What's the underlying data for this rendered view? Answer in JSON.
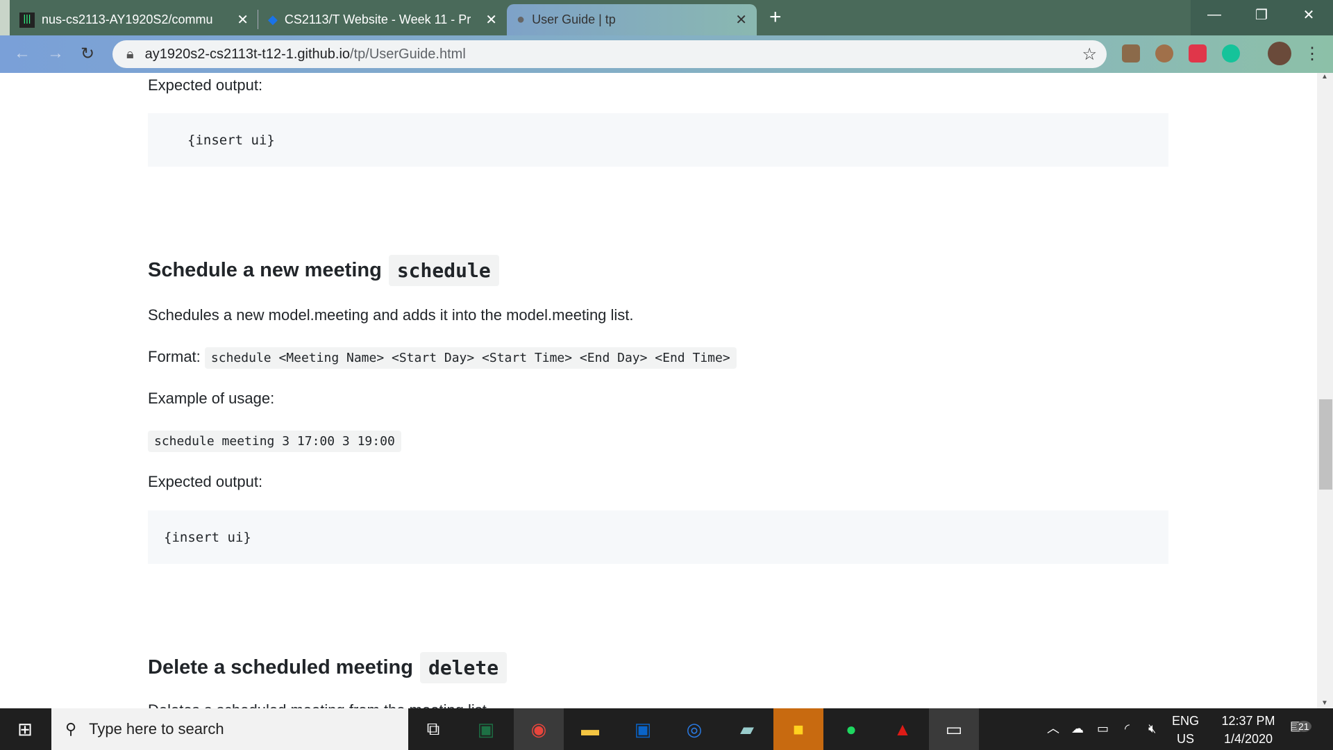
{
  "browser": {
    "tabs": [
      {
        "title": "nus-cs2113-AY1920S2/commu",
        "icon": "gitter-icon"
      },
      {
        "title": "CS2113/T Website - Week 11 - Pr",
        "icon": "graduation-cap-icon"
      },
      {
        "title": "User Guide | tp",
        "icon": "globe-icon",
        "active": true
      }
    ],
    "url_host": "ay1920s2-cs2113t-t12-1.github.io",
    "url_path": "/tp/UserGuide.html"
  },
  "content": {
    "expected_output_1": "Expected output:",
    "code_1": "{insert ui}",
    "schedule_heading": "Schedule a new meeting",
    "schedule_cmd": "schedule",
    "schedule_desc": "Schedules a new model.meeting and adds it into the model.meeting list.",
    "format_label": "Format:",
    "format_code": "schedule <Meeting Name> <Start Day> <Start Time> <End Day> <End Time>",
    "example_label": "Example of usage:",
    "example_code": "schedule meeting 3 17:00 3 19:00",
    "expected_output_2": "Expected output:",
    "code_2": "{insert ui}",
    "delete_heading": "Delete a scheduled meeting",
    "delete_cmd": "delete",
    "delete_desc": "Deletes a scheduled meeting from the meeting list."
  },
  "taskbar": {
    "search_placeholder": "Type here to search",
    "lang": "ENG",
    "region": "US",
    "time": "12:37 PM",
    "date": "1/4/2020",
    "notifications": "21"
  }
}
